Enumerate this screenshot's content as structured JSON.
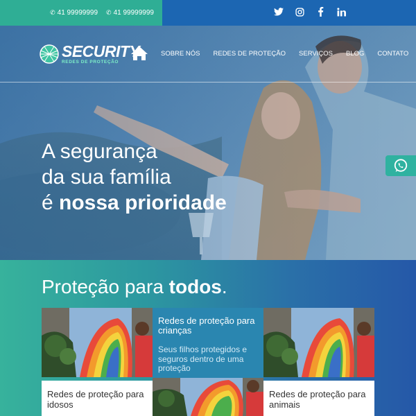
{
  "topbar": {
    "phones": [
      {
        "icon": "phone-icon",
        "number": "41 99999999"
      },
      {
        "icon": "whatsapp-icon",
        "number": "41 99999999"
      }
    ],
    "social": [
      {
        "name": "twitter-icon",
        "glyph": "🐦"
      },
      {
        "name": "instagram-icon",
        "glyph": "◎"
      },
      {
        "name": "facebook-icon",
        "glyph": "f"
      },
      {
        "name": "linkedin-icon",
        "glyph": "in"
      }
    ]
  },
  "brand": {
    "name": "SECURITY",
    "tagline": "REDES DE PROTEÇÃO"
  },
  "nav": {
    "items": [
      "SOBRE NÓS",
      "REDES DE PROTEÇÃO",
      "SERVIÇOS",
      "BLOG",
      "CONTATO"
    ]
  },
  "hero": {
    "line1": "A segurança",
    "line2": "da sua família",
    "line3_prefix": "é ",
    "line3_bold": "nossa prioridade"
  },
  "section": {
    "title_prefix": "Proteção para ",
    "title_bold": "todos",
    "title_suffix": "."
  },
  "cards": {
    "left_caption": "Redes de proteção para idosos",
    "right_caption": "Redes de proteção para animais",
    "feature_title": "Redes de proteção para crianças",
    "feature_text": "Seus filhos protegidos e seguros dentro de uma proteção"
  },
  "colors": {
    "topbar_left": "#2fae95",
    "topbar_right": "#1c66b2",
    "whatsapp": "#2fb2a0",
    "logo_accent": "#7ef0c8"
  }
}
